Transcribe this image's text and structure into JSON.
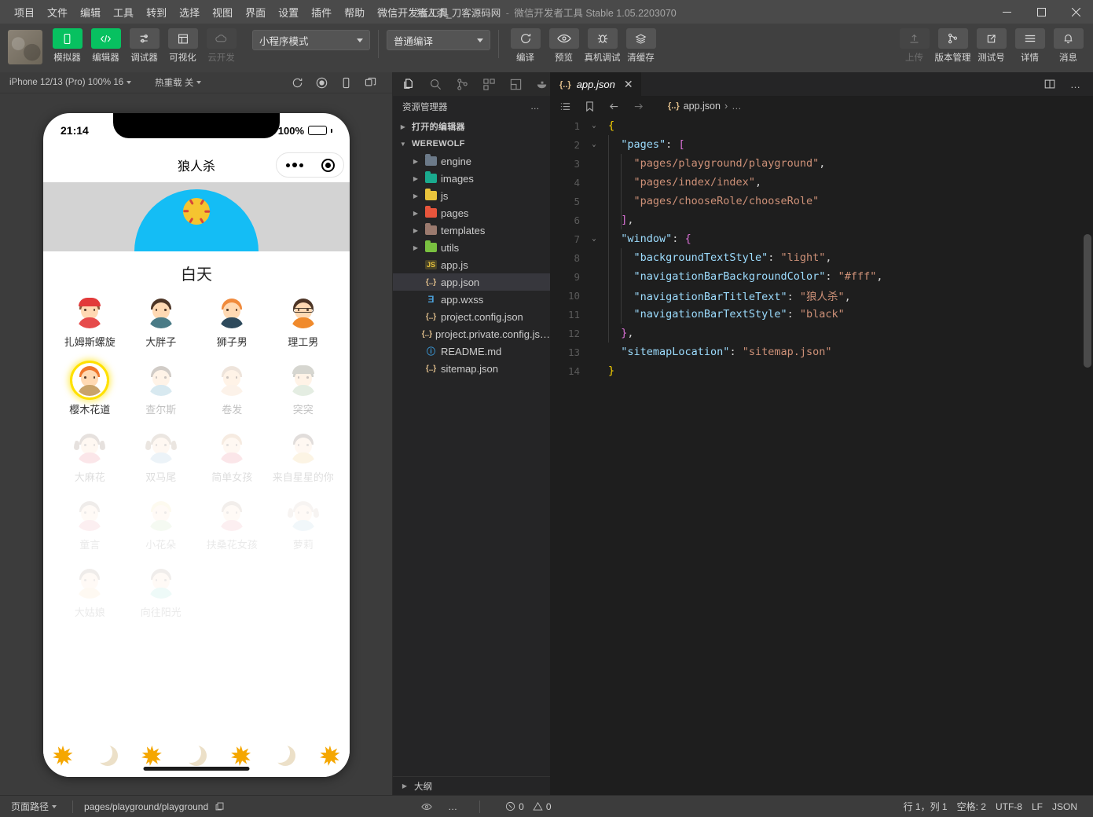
{
  "titlebar": {
    "menus": [
      "项目",
      "文件",
      "编辑",
      "工具",
      "转到",
      "选择",
      "视图",
      "界面",
      "设置",
      "插件",
      "帮助",
      "微信开发者工具"
    ],
    "project": "狼人杀_刀客源码网",
    "separator": "-",
    "app_name": "微信开发者工具",
    "version": "Stable 1.05.2203070",
    "minimize": "—",
    "maximize": "□",
    "close": "✕"
  },
  "toolbar": {
    "left_buttons": [
      {
        "label": "模拟器",
        "icon": "simulator-icon",
        "state": "active"
      },
      {
        "label": "编辑器",
        "icon": "code-icon",
        "state": "active"
      },
      {
        "label": "调试器",
        "icon": "debugger-icon",
        "state": "normal"
      },
      {
        "label": "可视化",
        "icon": "visualize-icon",
        "state": "normal"
      },
      {
        "label": "云开发",
        "icon": "cloud-icon",
        "state": "disabled"
      }
    ],
    "mode_select": "小程序模式",
    "compile_select": "普通编译",
    "mid_buttons": [
      {
        "label": "编译",
        "icon": "refresh-icon"
      },
      {
        "label": "预览",
        "icon": "eye-icon"
      },
      {
        "label": "真机调试",
        "icon": "bug-icon"
      },
      {
        "label": "清缓存",
        "icon": "layers-icon"
      }
    ],
    "right_buttons": [
      {
        "label": "上传",
        "icon": "upload-icon",
        "state": "disabled"
      },
      {
        "label": "版本管理",
        "icon": "git-branch-icon",
        "state": "normal"
      },
      {
        "label": "测试号",
        "icon": "external-link-icon",
        "state": "normal"
      },
      {
        "label": "详情",
        "icon": "menu-icon",
        "state": "normal"
      },
      {
        "label": "消息",
        "icon": "bell-icon",
        "state": "normal"
      }
    ]
  },
  "simulator": {
    "device": "iPhone 12/13 (Pro) 100% 16",
    "hot_reload": "热重载 关",
    "icons": [
      "refresh-icon",
      "record-icon",
      "rotate-device-icon",
      "multi-window-icon"
    ],
    "phone": {
      "time": "21:14",
      "battery_percent": "100%",
      "nav_title": "狼人杀",
      "period_label": "白天",
      "roles": [
        {
          "name": "扎姆斯螺旋",
          "state": "active",
          "style": "cap-red"
        },
        {
          "name": "大胖子",
          "state": "active",
          "style": "boy-brown"
        },
        {
          "name": "狮子男",
          "state": "active",
          "style": "boy-orange"
        },
        {
          "name": "理工男",
          "state": "active",
          "style": "boy-glasses"
        },
        {
          "name": "樱木花道",
          "state": "selected",
          "style": "boy-spiky"
        },
        {
          "name": "查尔斯",
          "state": "faded",
          "style": "boy-blue"
        },
        {
          "name": "卷发",
          "state": "faded",
          "style": "boy-curly"
        },
        {
          "name": "突突",
          "state": "faded",
          "style": "boy-hat"
        },
        {
          "name": "大麻花",
          "state": "faded2",
          "style": "girl-braids"
        },
        {
          "name": "双马尾",
          "state": "faded2",
          "style": "girl-twintails"
        },
        {
          "name": "简单女孩",
          "state": "faded2",
          "style": "girl-simple"
        },
        {
          "name": "来自星星的你",
          "state": "faded2",
          "style": "girl-dark"
        },
        {
          "name": "童言",
          "state": "faded3",
          "style": "girl-bob"
        },
        {
          "name": "小花朵",
          "state": "faded3",
          "style": "girl-blonde"
        },
        {
          "name": "扶桑花女孩",
          "state": "faded3",
          "style": "girl-flower"
        },
        {
          "name": "萝莉",
          "state": "faded3",
          "style": "girl-loli"
        },
        {
          "name": "大姑娘",
          "state": "faded3",
          "style": "girl-tan"
        },
        {
          "name": "向往阳光",
          "state": "faded3",
          "style": "girl-long"
        }
      ],
      "phases": [
        "sun",
        "moon",
        "sun",
        "moon",
        "sun",
        "moon",
        "sun"
      ]
    }
  },
  "explorer": {
    "activity_icons": [
      "files-icon",
      "search-icon",
      "source-control-icon",
      "extensions-icon",
      "layout-icon",
      "docker-icon"
    ],
    "title": "资源管理器",
    "more": "…",
    "open_editors": "打开的编辑器",
    "project_root": "WEREWOLF",
    "folders": [
      {
        "name": "engine",
        "color": "#6c7a89"
      },
      {
        "name": "images",
        "color": "#1aaa8e"
      },
      {
        "name": "js",
        "color": "#e8c33c"
      },
      {
        "name": "pages",
        "color": "#e8553c"
      },
      {
        "name": "templates",
        "color": "#9b7a6e"
      },
      {
        "name": "utils",
        "color": "#79c040"
      }
    ],
    "files": [
      {
        "name": "app.js",
        "icon": "js",
        "selected": false
      },
      {
        "name": "app.json",
        "icon": "json",
        "selected": true
      },
      {
        "name": "app.wxss",
        "icon": "css",
        "selected": false
      },
      {
        "name": "project.config.json",
        "icon": "json",
        "selected": false
      },
      {
        "name": "project.private.config.js…",
        "icon": "json",
        "selected": false
      },
      {
        "name": "README.md",
        "icon": "info",
        "selected": false
      },
      {
        "name": "sitemap.json",
        "icon": "json",
        "selected": false
      }
    ],
    "outline": "大纲"
  },
  "editor": {
    "tab_name": "app.json",
    "tab_icon": "{..}",
    "tab_close": "✕",
    "breadcrumb_file": "app.json",
    "breadcrumb_chevron": "›",
    "breadcrumb_more": "…",
    "lines": [
      {
        "n": "1",
        "fold": "v",
        "tokens": [
          {
            "t": "{",
            "c": "br2"
          }
        ]
      },
      {
        "n": "2",
        "fold": "v",
        "tokens": [
          {
            "t": "  ",
            "c": "p"
          },
          {
            "t": "\"pages\"",
            "c": "k"
          },
          {
            "t": ": ",
            "c": "p"
          },
          {
            "t": "[",
            "c": "br"
          }
        ]
      },
      {
        "n": "3",
        "fold": "",
        "tokens": [
          {
            "t": "    ",
            "c": "p"
          },
          {
            "t": "\"pages/playground/playground\"",
            "c": "s"
          },
          {
            "t": ",",
            "c": "p"
          }
        ]
      },
      {
        "n": "4",
        "fold": "",
        "tokens": [
          {
            "t": "    ",
            "c": "p"
          },
          {
            "t": "\"pages/index/index\"",
            "c": "s"
          },
          {
            "t": ",",
            "c": "p"
          }
        ]
      },
      {
        "n": "5",
        "fold": "",
        "tokens": [
          {
            "t": "    ",
            "c": "p"
          },
          {
            "t": "\"pages/chooseRole/chooseRole\"",
            "c": "s"
          }
        ]
      },
      {
        "n": "6",
        "fold": "",
        "tokens": [
          {
            "t": "  ",
            "c": "p"
          },
          {
            "t": "]",
            "c": "br"
          },
          {
            "t": ",",
            "c": "p"
          }
        ]
      },
      {
        "n": "7",
        "fold": "v",
        "tokens": [
          {
            "t": "  ",
            "c": "p"
          },
          {
            "t": "\"window\"",
            "c": "k"
          },
          {
            "t": ": ",
            "c": "p"
          },
          {
            "t": "{",
            "c": "br"
          }
        ]
      },
      {
        "n": "8",
        "fold": "",
        "tokens": [
          {
            "t": "    ",
            "c": "p"
          },
          {
            "t": "\"backgroundTextStyle\"",
            "c": "k"
          },
          {
            "t": ": ",
            "c": "p"
          },
          {
            "t": "\"light\"",
            "c": "s"
          },
          {
            "t": ",",
            "c": "p"
          }
        ]
      },
      {
        "n": "9",
        "fold": "",
        "tokens": [
          {
            "t": "    ",
            "c": "p"
          },
          {
            "t": "\"navigationBarBackgroundColor\"",
            "c": "k"
          },
          {
            "t": ": ",
            "c": "p"
          },
          {
            "t": "\"#fff\"",
            "c": "s"
          },
          {
            "t": ",",
            "c": "p"
          }
        ]
      },
      {
        "n": "10",
        "fold": "",
        "tokens": [
          {
            "t": "    ",
            "c": "p"
          },
          {
            "t": "\"navigationBarTitleText\"",
            "c": "k"
          },
          {
            "t": ": ",
            "c": "p"
          },
          {
            "t": "\"狼人杀\"",
            "c": "s"
          },
          {
            "t": ",",
            "c": "p"
          }
        ]
      },
      {
        "n": "11",
        "fold": "",
        "tokens": [
          {
            "t": "    ",
            "c": "p"
          },
          {
            "t": "\"navigationBarTextStyle\"",
            "c": "k"
          },
          {
            "t": ": ",
            "c": "p"
          },
          {
            "t": "\"black\"",
            "c": "s"
          }
        ]
      },
      {
        "n": "12",
        "fold": "",
        "tokens": [
          {
            "t": "  ",
            "c": "p"
          },
          {
            "t": "}",
            "c": "br"
          },
          {
            "t": ",",
            "c": "p"
          }
        ]
      },
      {
        "n": "13",
        "fold": "",
        "tokens": [
          {
            "t": "  ",
            "c": "p"
          },
          {
            "t": "\"sitemapLocation\"",
            "c": "k"
          },
          {
            "t": ": ",
            "c": "p"
          },
          {
            "t": "\"sitemap.json\"",
            "c": "s"
          }
        ]
      },
      {
        "n": "14",
        "fold": "",
        "tokens": [
          {
            "t": "}",
            "c": "br2"
          }
        ]
      }
    ]
  },
  "statusbar": {
    "page_path_label": "页面路径",
    "page_path": "pages/playground/playground",
    "copy_icon": "copy-icon",
    "eye_icon": "eye-icon",
    "more": "…",
    "errors": "0",
    "warnings": "0",
    "cursor": "行 1，列 1",
    "spaces": "空格: 2",
    "encoding": "UTF-8",
    "eol": "LF",
    "language": "JSON"
  }
}
